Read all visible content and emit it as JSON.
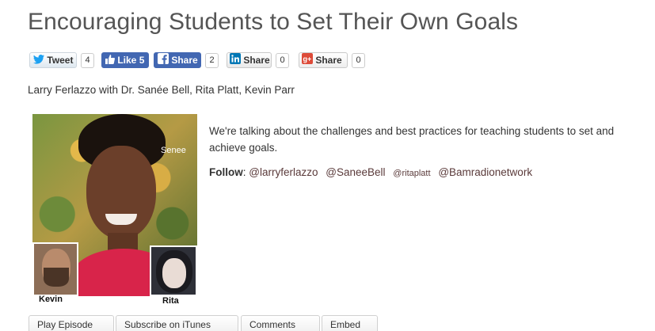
{
  "article": {
    "title": "Encouraging Students to Set Their Own Goals",
    "byline": "Larry Ferlazzo with Dr. Sanée Bell, Rita Platt, Kevin Parr",
    "description": "We're talking about the challenges and best practices for teaching students to set and achieve goals.",
    "follow_label": "Follow",
    "follow_handles": [
      "@larryferlazzo",
      "@SaneeBell",
      "@ritaplatt",
      "@Bamradionetwork"
    ]
  },
  "share": {
    "tweet_label": "Tweet",
    "tweet_count": "4",
    "like_label": "Like 5",
    "fb_share_label": "Share",
    "fb_share_count": "2",
    "linkedin_label": "Share",
    "linkedin_count": "0",
    "gplus_label": "Share",
    "gplus_count": "0"
  },
  "image": {
    "label_senee": "Senee",
    "label_kevin": "Kevin",
    "label_rita": "Rita"
  },
  "tabs": [
    "Play Episode",
    "Subscribe on iTunes",
    "Comments",
    "Embed"
  ],
  "colors": {
    "facebook": "#4267b2",
    "twitter": "#1da1f2",
    "linkedin": "#0077b5",
    "gplus": "#dd4b39"
  }
}
